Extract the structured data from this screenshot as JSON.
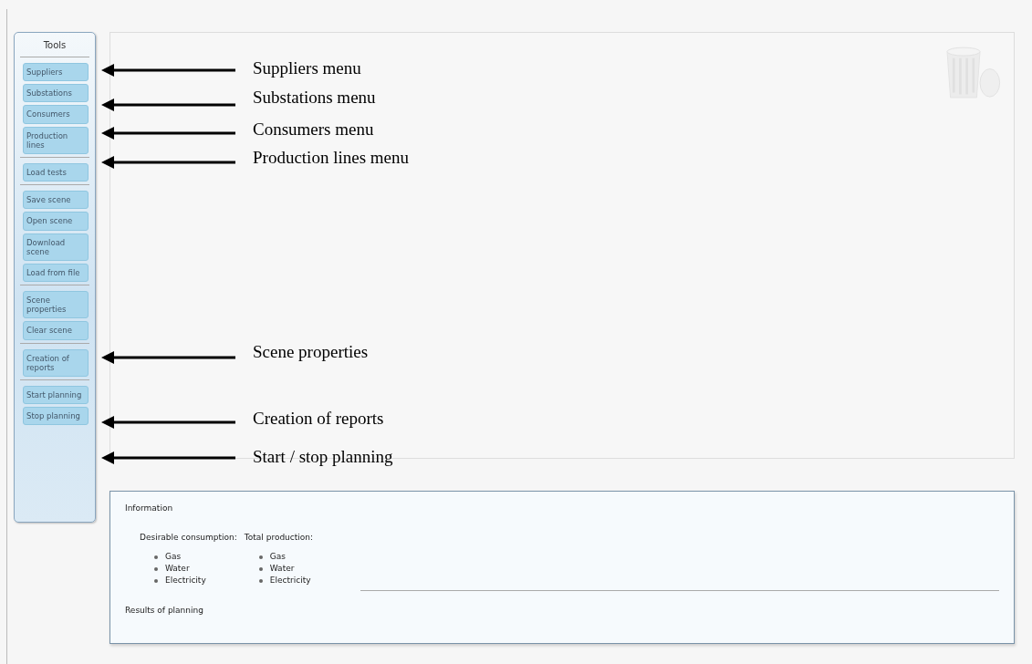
{
  "tools": {
    "title": "Tools",
    "groups": [
      [
        "Suppliers",
        "Substations",
        "Consumers",
        "Production lines"
      ],
      [
        "Load tests"
      ],
      [
        "Save scene",
        "Open scene",
        "Download scene",
        "Load from file"
      ],
      [
        "Scene properties",
        "Clear scene"
      ],
      [
        "Creation of reports"
      ],
      [
        "Start planning",
        "Stop planning"
      ]
    ]
  },
  "annotations": [
    {
      "text": "Suppliers menu"
    },
    {
      "text": "Substations menu"
    },
    {
      "text": "Consumers menu"
    },
    {
      "text": "Production lines menu"
    },
    {
      "text": "Scene properties"
    },
    {
      "text": "Creation of reports"
    },
    {
      "text": "Start / stop planning"
    }
  ],
  "info": {
    "title": "Information",
    "columns": [
      {
        "heading": "Desirable consumption:",
        "items": [
          "Gas",
          "Water",
          "Electricity"
        ]
      },
      {
        "heading": "Total production:",
        "items": [
          "Gas",
          "Water",
          "Electricity"
        ]
      }
    ],
    "results_title": "Results of planning"
  }
}
